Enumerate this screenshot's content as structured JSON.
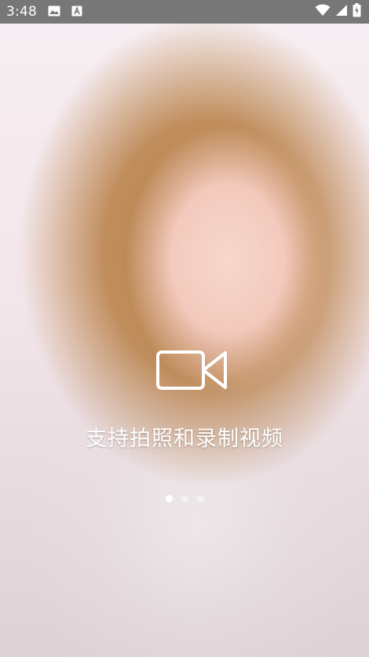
{
  "status_bar": {
    "time": "3:48",
    "notification_icons": [
      "image-icon",
      "a-letter-icon"
    ],
    "system_icons": [
      "wifi-icon",
      "cell-signal-icon",
      "battery-charging-icon"
    ]
  },
  "slide": {
    "icon": "video-camera-icon",
    "caption": "支持拍照和录制视频",
    "pages": {
      "total": 3,
      "current": 1
    }
  },
  "colors": {
    "status_bar_bg": "#777777",
    "caption_text": "#ffffff",
    "dot_active": "#ffffff",
    "dot_inactive": "#ffffff73"
  }
}
